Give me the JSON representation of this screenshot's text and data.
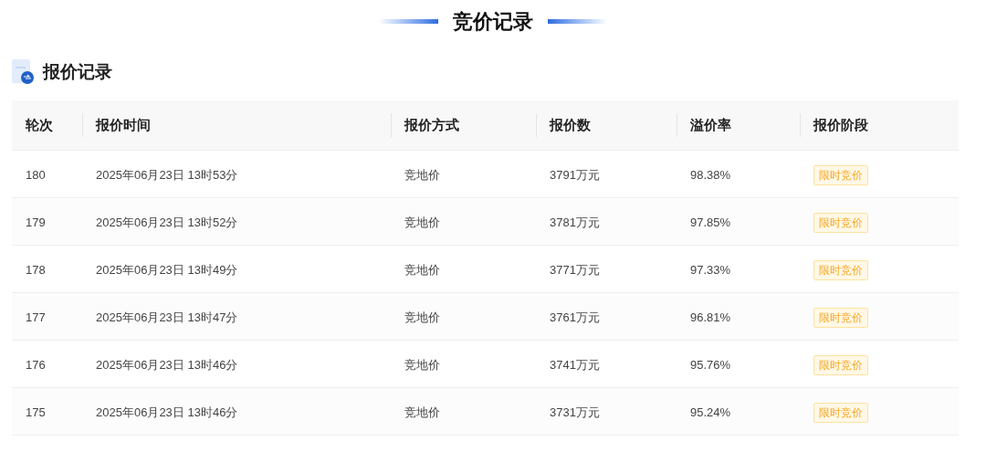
{
  "page_title": "竞价记录",
  "section_title": "报价记录",
  "table": {
    "columns": [
      "轮次",
      "报价时间",
      "报价方式",
      "报价数",
      "溢价率",
      "报价阶段"
    ],
    "rows": [
      {
        "round": "180",
        "time": "2025年06月23日 13时53分",
        "method": "竞地价",
        "amount": "3791万元",
        "premium": "98.38%",
        "stage": "限时竞价"
      },
      {
        "round": "179",
        "time": "2025年06月23日 13时52分",
        "method": "竞地价",
        "amount": "3781万元",
        "premium": "97.85%",
        "stage": "限时竞价"
      },
      {
        "round": "178",
        "time": "2025年06月23日 13时49分",
        "method": "竞地价",
        "amount": "3771万元",
        "premium": "97.33%",
        "stage": "限时竞价"
      },
      {
        "round": "177",
        "time": "2025年06月23日 13时47分",
        "method": "竞地价",
        "amount": "3761万元",
        "premium": "96.81%",
        "stage": "限时竞价"
      },
      {
        "round": "176",
        "time": "2025年06月23日 13时46分",
        "method": "竞地价",
        "amount": "3741万元",
        "premium": "95.76%",
        "stage": "限时竞价"
      },
      {
        "round": "175",
        "time": "2025年06月23日 13时46分",
        "method": "竞地价",
        "amount": "3731万元",
        "premium": "95.24%",
        "stage": "限时竞价"
      }
    ]
  }
}
